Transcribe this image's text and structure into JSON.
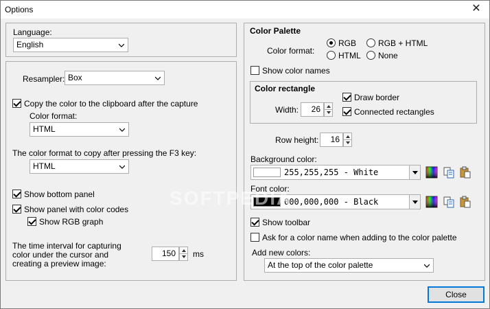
{
  "window": {
    "title": "Options"
  },
  "watermark": "SOFTPEDIA",
  "left": {
    "language_label": "Language:",
    "language_value": "English",
    "resampler_label": "Resampler:",
    "resampler_value": "Box",
    "copy_clipboard_label": "Copy the color to the clipboard after the capture",
    "copy_clipboard_checked": true,
    "color_format_label": "Color format:",
    "color_format_value": "HTML",
    "f3_label": "The color format to copy after pressing the F3 key:",
    "f3_value": "HTML",
    "show_bottom_panel_label": "Show bottom panel",
    "show_bottom_panel_checked": true,
    "show_color_codes_label": "Show panel with color codes",
    "show_color_codes_checked": true,
    "show_rgb_graph_label": "Show RGB graph",
    "show_rgb_graph_checked": true,
    "interval_label_1": "The time interval for capturing",
    "interval_label_2": "color under the cursor and",
    "interval_label_3": "creating a preview image:",
    "interval_value": "150",
    "interval_unit": "ms"
  },
  "right": {
    "section_title": "Color Palette",
    "color_format_label": "Color format:",
    "radio_rgb": "RGB",
    "radio_rgb_html": "RGB + HTML",
    "radio_html": "HTML",
    "radio_none": "None",
    "selected_format": "RGB",
    "show_color_names_label": "Show color names",
    "show_color_names_checked": false,
    "color_rect_title": "Color rectangle",
    "width_label": "Width:",
    "width_value": "26",
    "draw_border_label": "Draw border",
    "draw_border_checked": true,
    "connected_rects_label": "Connected rectangles",
    "connected_rects_checked": true,
    "row_height_label": "Row height:",
    "row_height_value": "16",
    "bg_color_label": "Background color:",
    "bg_color_value": "255,255,255  -  White",
    "bg_swatch": "#ffffff",
    "font_color_label": "Font color:",
    "font_color_value": "000,000,000  -  Black",
    "font_swatch": "#000000",
    "show_toolbar_label": "Show toolbar",
    "show_toolbar_checked": true,
    "ask_name_label": "Ask for a color name when adding to the color palette",
    "ask_name_checked": false,
    "add_new_label": "Add new colors:",
    "add_new_value": "At the top of the color palette"
  },
  "footer": {
    "close_label": "Close"
  },
  "colors": {
    "accent": "#0078d7",
    "panel_bg": "#f0f0f0",
    "border": "#adadad"
  }
}
